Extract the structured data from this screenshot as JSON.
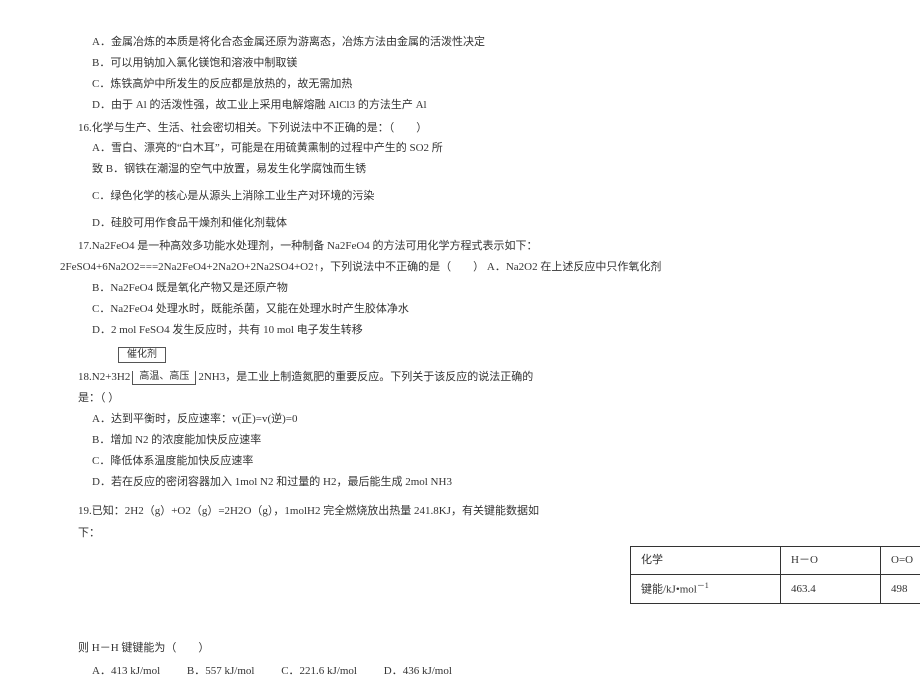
{
  "q15_opts": {
    "a": "A．金属冶炼的本质是将化合态金属还原为游离态，冶炼方法由金属的活泼性决定",
    "b": "B．可以用钠加入氯化镁饱和溶液中制取镁",
    "c": "C．炼铁高炉中所发生的反应都是放热的，故无需加热",
    "d": "D．由于 Al 的活泼性强，故工业上采用电解熔融 AlCl3 的方法生产 Al"
  },
  "q16": {
    "stem": "16.化学与生产、生活、社会密切相关。下列说法中不正确的是：（　　）",
    "a1": "A．雪白、漂亮的“白木耳”，可能是在用硫黄熏制的过程中产生的 SO2 所",
    "a2": "致 B．钢铁在潮湿的空气中放置，易发生化学腐蚀而生锈",
    "c": "C．绿色化学的核心是从源头上消除工业生产对环境的污染",
    "d": "D．硅胶可用作食品干燥剂和催化剂载体"
  },
  "q17": {
    "stem1": "17.Na2FeO4 是一种高效多功能水处理剂，一种制备 Na2FeO4 的方法可用化学方程式表示如下：",
    "stem2": "2FeSO4+6Na2O2===2Na2FeO4+2Na2O+2Na2SO4+O2↑，下列说法中不正确的是（　　） A．Na2O2 在上述反应中只作氧化剂",
    "b": "B．Na2FeO4 既是氧化产物又是还原产物",
    "c": "C．Na2FeO4 处理水时，既能杀菌，又能在处理水时产生胶体净水",
    "d": "D．2 mol FeSO4 发生反应时，共有 10 mol 电子发生转移"
  },
  "q18": {
    "cat_top": "催化剂",
    "cat_bottom": "高温、高压",
    "pre": "18.N2+3H2",
    "post": "2NH3，是工业上制造氮肥的重要反应。下列关于该反应的说法正确的",
    "stem2": "是：（   ）",
    "a": "A．达到平衡时，反应速率：v(正)=v(逆)=0",
    "b": "B．增加 N2 的浓度能加快反应速率",
    "c": "C．降低体系温度能加快反应速率",
    "d": "D．若在反应的密闭容器加入 1mol N2 和过量的 H2，最后能生成 2mol NH3"
  },
  "q19": {
    "stem1": "19.已知：2H2（g）+O2（g）=2H2O（g），1molH2 完全燃烧放出热量 241.8KJ，有关键能数据如",
    "stem2": "下：",
    "table": {
      "h1": "化学",
      "h2": "H－O",
      "h3": "O=O",
      "r1": "键能/kJ•mol",
      "r1_sup": "－1",
      "r2": "463.4",
      "r3": "498"
    },
    "ask": "则 H－H 键键能为（　　）",
    "opts": {
      "a": "A．413 kJ/mol",
      "b": "B．557 kJ/mol",
      "c": "C．221.6 kJ/mol",
      "d": "D．436 kJ/mol"
    }
  }
}
